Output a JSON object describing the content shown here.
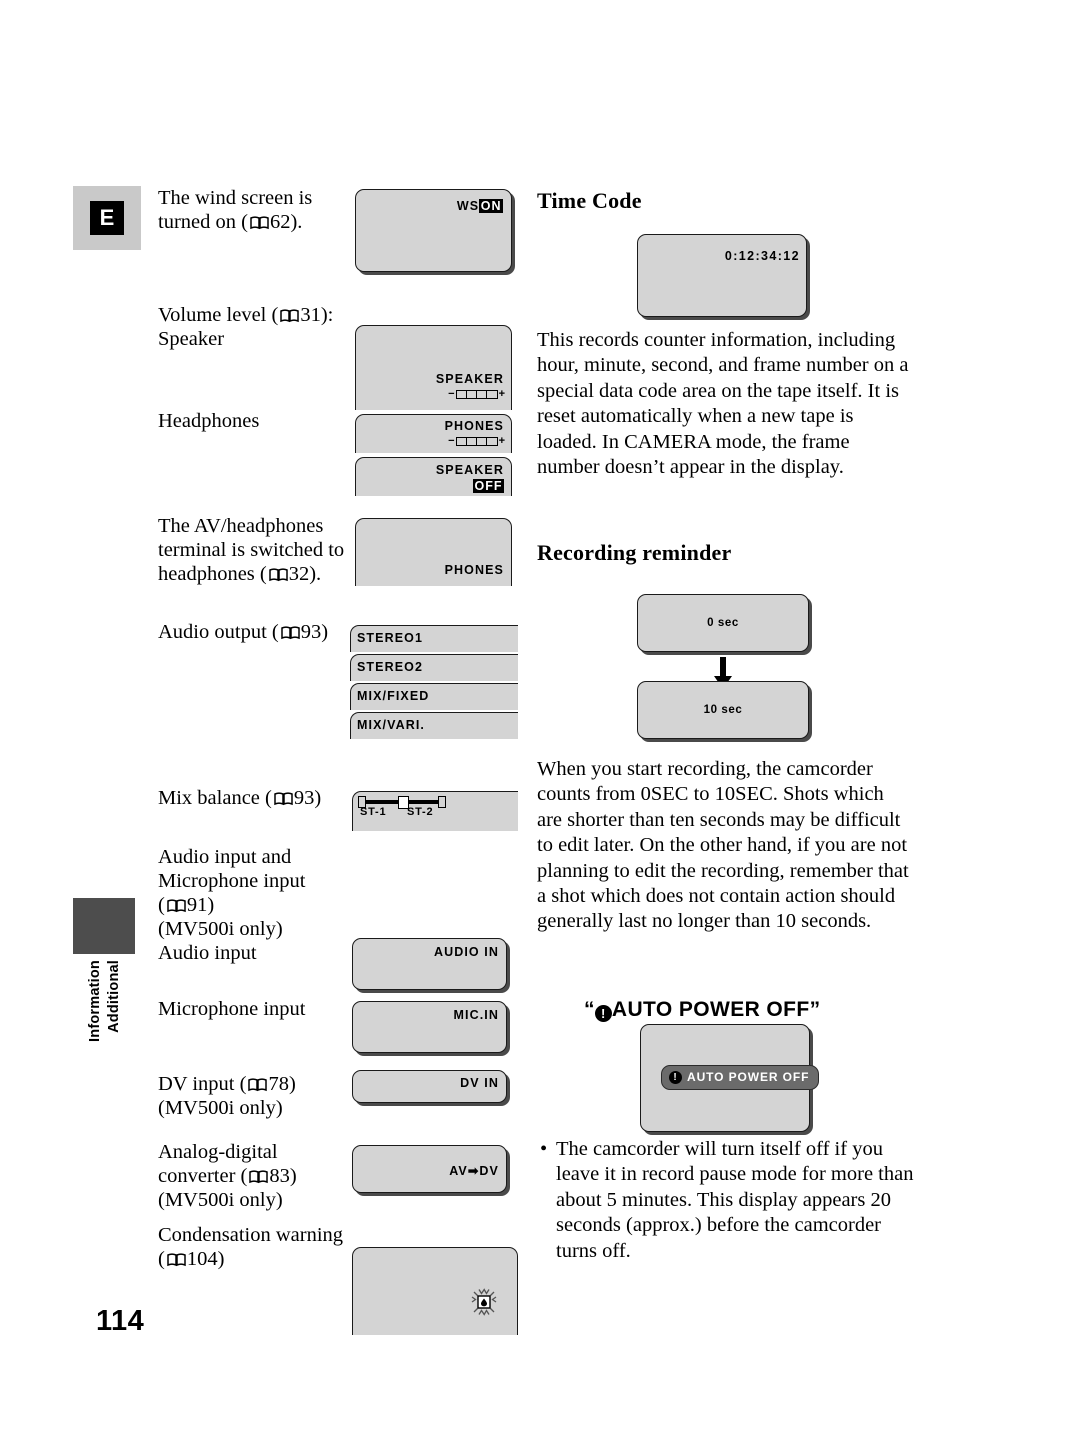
{
  "page": {
    "number": "114",
    "language_badge": "E",
    "side_tab_line1": "Additional",
    "side_tab_line2": "Information"
  },
  "left_column": {
    "items": [
      {
        "id": "wind-screen",
        "label_html": "The wind screen is turned on (",
        "label_text": "The wind screen is turned on (",
        "page_ref": "62",
        "label_tail": ").",
        "screen_osd": "WS",
        "screen_chip": "ON"
      },
      {
        "id": "volume-speaker",
        "label_text": "Volume level (",
        "page_ref": "31",
        "label_tail": "): Speaker",
        "screen_osd": "SPEAKER"
      },
      {
        "id": "headphones",
        "label_text": "Headphones",
        "screen_osd": "PHONES"
      },
      {
        "id": "speaker-off",
        "screen_osd": "SPEAKER",
        "screen_chip": "OFF"
      },
      {
        "id": "av-headphones",
        "label_text": "The AV/headphones terminal is switched to headphones (",
        "page_ref": "32",
        "label_tail": ").",
        "screen_osd": "PHONES"
      },
      {
        "id": "audio-output",
        "label_text": "Audio output (",
        "page_ref": "93",
        "label_tail": ")",
        "options": [
          "STEREO1",
          "STEREO2",
          "MIX/FIXED",
          "MIX/VARI."
        ]
      },
      {
        "id": "mix-balance",
        "label_text": "Mix balance (",
        "page_ref": "93",
        "label_tail": ")",
        "slider_left_label": "ST-1",
        "slider_right_label": "ST-2"
      },
      {
        "id": "audio-mic-input",
        "label_line1": "Audio input and",
        "label_line2": "Microphone input",
        "page_ref": "91",
        "label_line3": "(MV500i only)",
        "label_line4": "Audio input",
        "screen_osd": "AUDIO IN"
      },
      {
        "id": "microphone-input",
        "label_text": "Microphone input",
        "screen_osd": "MIC.IN"
      },
      {
        "id": "dv-input",
        "label_text": "DV input (",
        "page_ref": "78",
        "label_tail": ")",
        "label_line2": "(MV500i only)",
        "screen_osd": "DV IN"
      },
      {
        "id": "analog-digital-converter",
        "label_line1": "Analog-digital",
        "label_line2": "converter (",
        "page_ref": "83",
        "label_tail": ")",
        "label_line3": "(MV500i only)",
        "screen_osd": "AV➡DV"
      },
      {
        "id": "condensation-warning",
        "label_line1": "Condensation warning",
        "label_line2": "(",
        "page_ref": "104",
        "label_tail": ")",
        "screen_icon": "condensation-blink-icon"
      }
    ]
  },
  "right_column": {
    "time_code": {
      "heading": "Time Code",
      "screen_osd": "0:12:34:12",
      "body": "This records counter information, including hour, minute, second, and frame number on a special data code area on the tape itself. It is reset automatically when a new tape is loaded. In CAMERA mode, the frame number doesn’t appear in the display."
    },
    "recording_reminder": {
      "heading": "Recording reminder",
      "screen_osd_top": "0 sec",
      "screen_osd_bottom": "10 sec",
      "body": "When you start recording, the camcorder counts from 0SEC to 10SEC. Shots which are shorter than ten seconds may be difficult to edit later. On the other hand, if you are not planning to edit the recording, remember that a shot which does not contain action should generally last no longer than 10 seconds."
    },
    "auto_power_off": {
      "heading_prefix": "“",
      "heading_text": "AUTO POWER OFF",
      "heading_suffix": "”",
      "badge_text": "AUTO POWER OFF",
      "bullet": "The camcorder will turn itself off if you leave it in record pause mode for more than about 5 minutes. This display appears 20 seconds (approx.) before the camcorder turns off.",
      "bullet_marker": "•"
    }
  }
}
